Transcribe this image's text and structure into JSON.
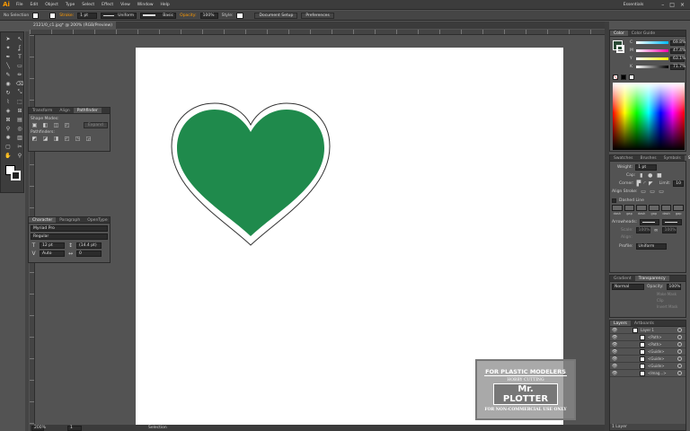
{
  "app": {
    "logo": "Ai",
    "menus": [
      "File",
      "Edit",
      "Object",
      "Type",
      "Select",
      "Effect",
      "View",
      "Window",
      "Help"
    ],
    "workspace": "Essentials"
  },
  "control": {
    "selection": "No Selection",
    "stroke_label": "Stroke:",
    "stroke_value": "1 pt",
    "profile": "Uniform",
    "brush": "Basic",
    "opacity_label": "Opacity:",
    "opacity_value": "100%",
    "style_label": "Style:",
    "doc_setup": "Document Setup",
    "preferences": "Preferences"
  },
  "document": {
    "tab_title": "2121/0_c1.jpg* @ 200% (RGB/Preview)",
    "zoom": "200%",
    "page": "1",
    "status": "Selection"
  },
  "pathfinder": {
    "tabs": [
      "Transform",
      "Align",
      "Pathfinder"
    ],
    "shape_modes": "Shape Modes:",
    "pathfinders": "Pathfinders:",
    "expand": "Expand"
  },
  "character": {
    "tabs": [
      "Character",
      "Paragraph",
      "OpenType"
    ],
    "font": "Myriad Pro",
    "style": "Regular",
    "size": "12 pt",
    "leading": "(14.4 pt)",
    "kerning": "Auto",
    "tracking": "0"
  },
  "color": {
    "tabs": [
      "Color",
      "Color Guide"
    ],
    "channels": [
      {
        "label": "C",
        "value": "69.8%"
      },
      {
        "label": "M",
        "value": "47.4%"
      },
      {
        "label": "Y",
        "value": "63.1%"
      },
      {
        "label": "K",
        "value": "71.7%"
      }
    ]
  },
  "stroke": {
    "tabs": [
      "Swatches",
      "Brushes",
      "Symbols",
      "Stroke"
    ],
    "weight_label": "Weight:",
    "weight_value": "1 pt",
    "cap_label": "Cap:",
    "corner_label": "Corner:",
    "limit_label": "Limit:",
    "limit_value": "10",
    "align_label": "Align Stroke:",
    "dashed_label": "Dashed Line",
    "dash_labels": [
      "dash",
      "gap",
      "dash",
      "gap",
      "dash",
      "gap"
    ],
    "arrowheads_label": "Arrowheads:",
    "scale_label": "Scale:",
    "scale_a": "100%",
    "scale_b": "100%",
    "align2_label": "Align:",
    "profile_label": "Profile:",
    "profile_value": "Uniform"
  },
  "transparency": {
    "tabs": [
      "Gradient",
      "Transparency"
    ],
    "mode": "Normal",
    "opacity_label": "Opacity:",
    "opacity_value": "100%",
    "options": [
      "Make Mask",
      "Clip",
      "Invert Mask"
    ]
  },
  "layers": {
    "tabs": [
      "Layers",
      "Artboards"
    ],
    "items": [
      {
        "name": "Layer 1",
        "top": true
      },
      {
        "name": "<Path>"
      },
      {
        "name": "<Path>"
      },
      {
        "name": "<Guide>"
      },
      {
        "name": "<Guide>"
      },
      {
        "name": "<Guide>"
      },
      {
        "name": "<Imag...>"
      }
    ],
    "footer": "1 Layer"
  },
  "watermark": {
    "line1": "FOR PLASTIC MODELERS",
    "line2": "HOBBY CUTTING",
    "line3": "Mr. PLOTTER",
    "line4": "FOR NON-COMMERCIAL USE ONLY"
  },
  "colors": {
    "heart_fill": "#1f8a4c",
    "app_bg": "#535353",
    "panel_bg": "#535353",
    "accent": "#ff9a00"
  }
}
